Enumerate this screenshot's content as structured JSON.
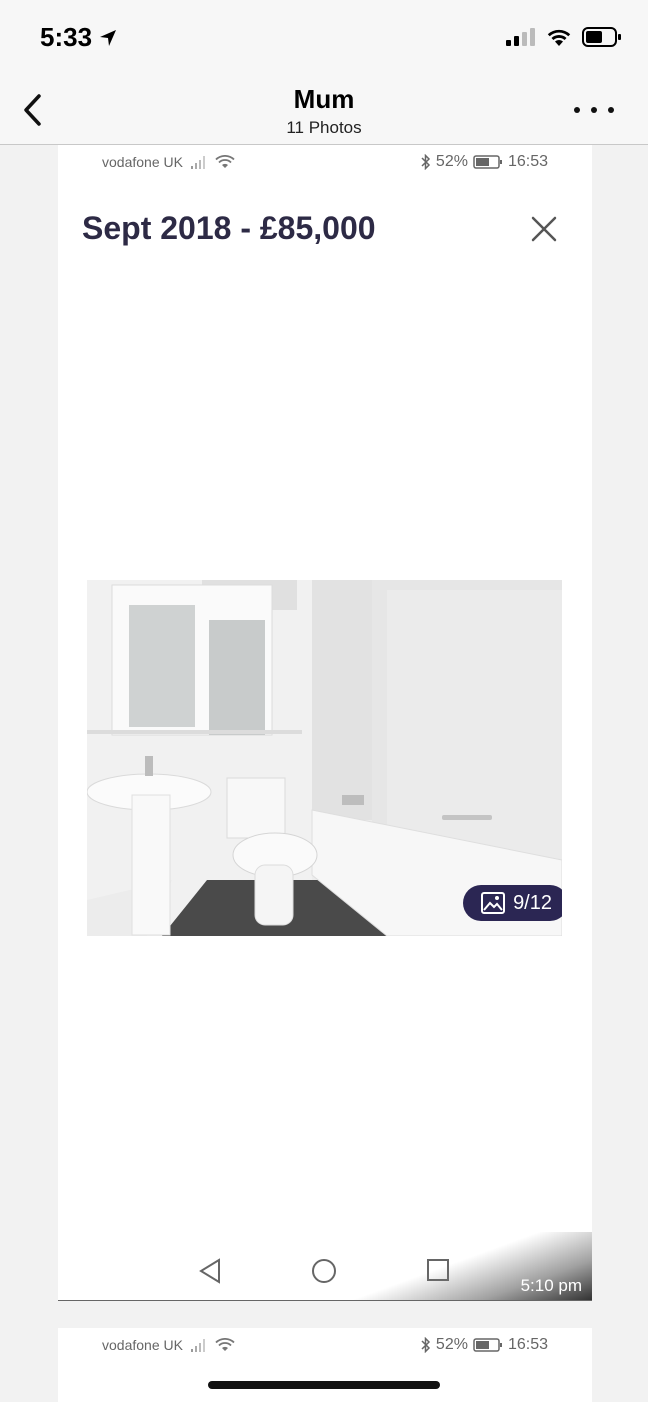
{
  "status_bar": {
    "time": "5:33"
  },
  "nav": {
    "title": "Mum",
    "subtitle": "11 Photos"
  },
  "screenshot": {
    "android_status": {
      "carrier": "vodafone UK",
      "battery": "52%",
      "clock": "16:53"
    },
    "listing_title": "Sept 2018 - £85,000",
    "photo_counter": "9/12",
    "timestamp": "5:10 pm"
  },
  "screenshot2": {
    "android_status": {
      "carrier": "vodafone UK",
      "battery": "52%",
      "clock": "16:53"
    }
  },
  "colors": {
    "title": "#2d2a45",
    "badge_bg": "#2b2653"
  }
}
